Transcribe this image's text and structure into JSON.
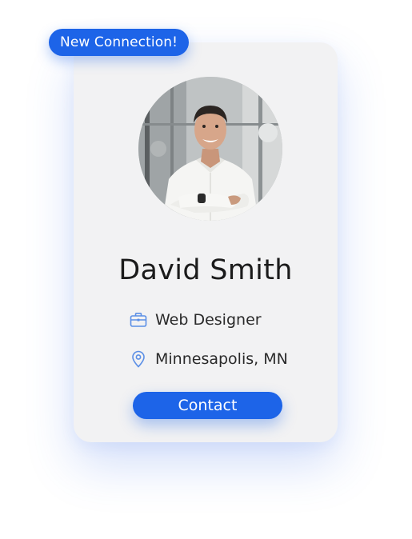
{
  "badge": {
    "label": "New Connection!"
  },
  "profile": {
    "name": "David Smith",
    "job_title": "Web Designer",
    "location": "Minnesapolis, MN",
    "job_icon": "briefcase-icon",
    "location_icon": "map-pin-icon"
  },
  "actions": {
    "contact_label": "Contact"
  },
  "colors": {
    "accent": "#1d64e8",
    "card_bg": "#f2f2f3",
    "icon": "#5b8fe6"
  }
}
